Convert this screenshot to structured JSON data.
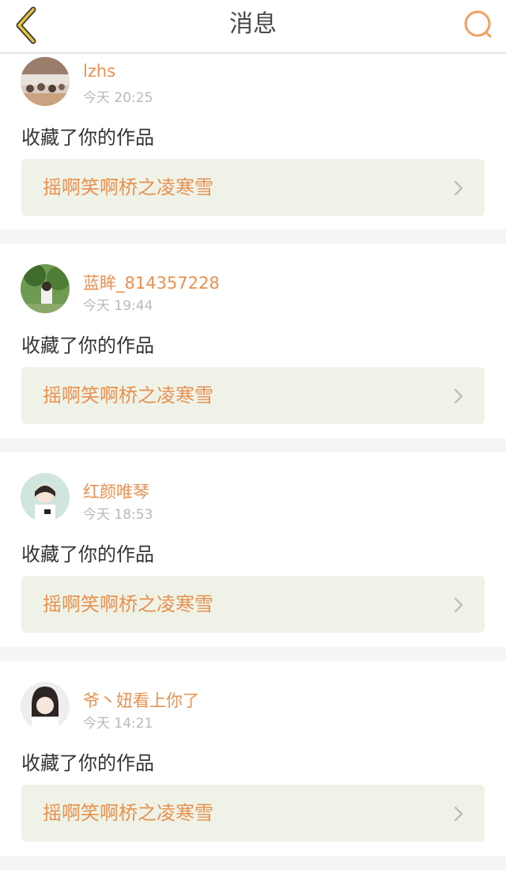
{
  "header": {
    "title": "消息",
    "back_icon": "chevron-left-icon",
    "search_icon": "search-icon",
    "accent": "#f0a060"
  },
  "messages": [
    {
      "username": "lzhs",
      "time": "今天 20:25",
      "action": "收藏了你的作品",
      "work": "摇啊笑啊桥之凌寒雪"
    },
    {
      "username": "蓝眸_814357228",
      "time": "今天 19:44",
      "action": "收藏了你的作品",
      "work": "摇啊笑啊桥之凌寒雪"
    },
    {
      "username": "红颜唯琴",
      "time": "今天 18:53",
      "action": "收藏了你的作品",
      "work": "摇啊笑啊桥之凌寒雪"
    },
    {
      "username": "爷丶妞看上你了",
      "time": "今天 14:21",
      "action": "收藏了你的作品",
      "work": "摇啊笑啊桥之凌寒雪"
    }
  ],
  "colors": {
    "username": "#e8904f",
    "time": "#b9b9b9",
    "work_bg": "#eff3e7",
    "divider": "#f5f5f5"
  }
}
